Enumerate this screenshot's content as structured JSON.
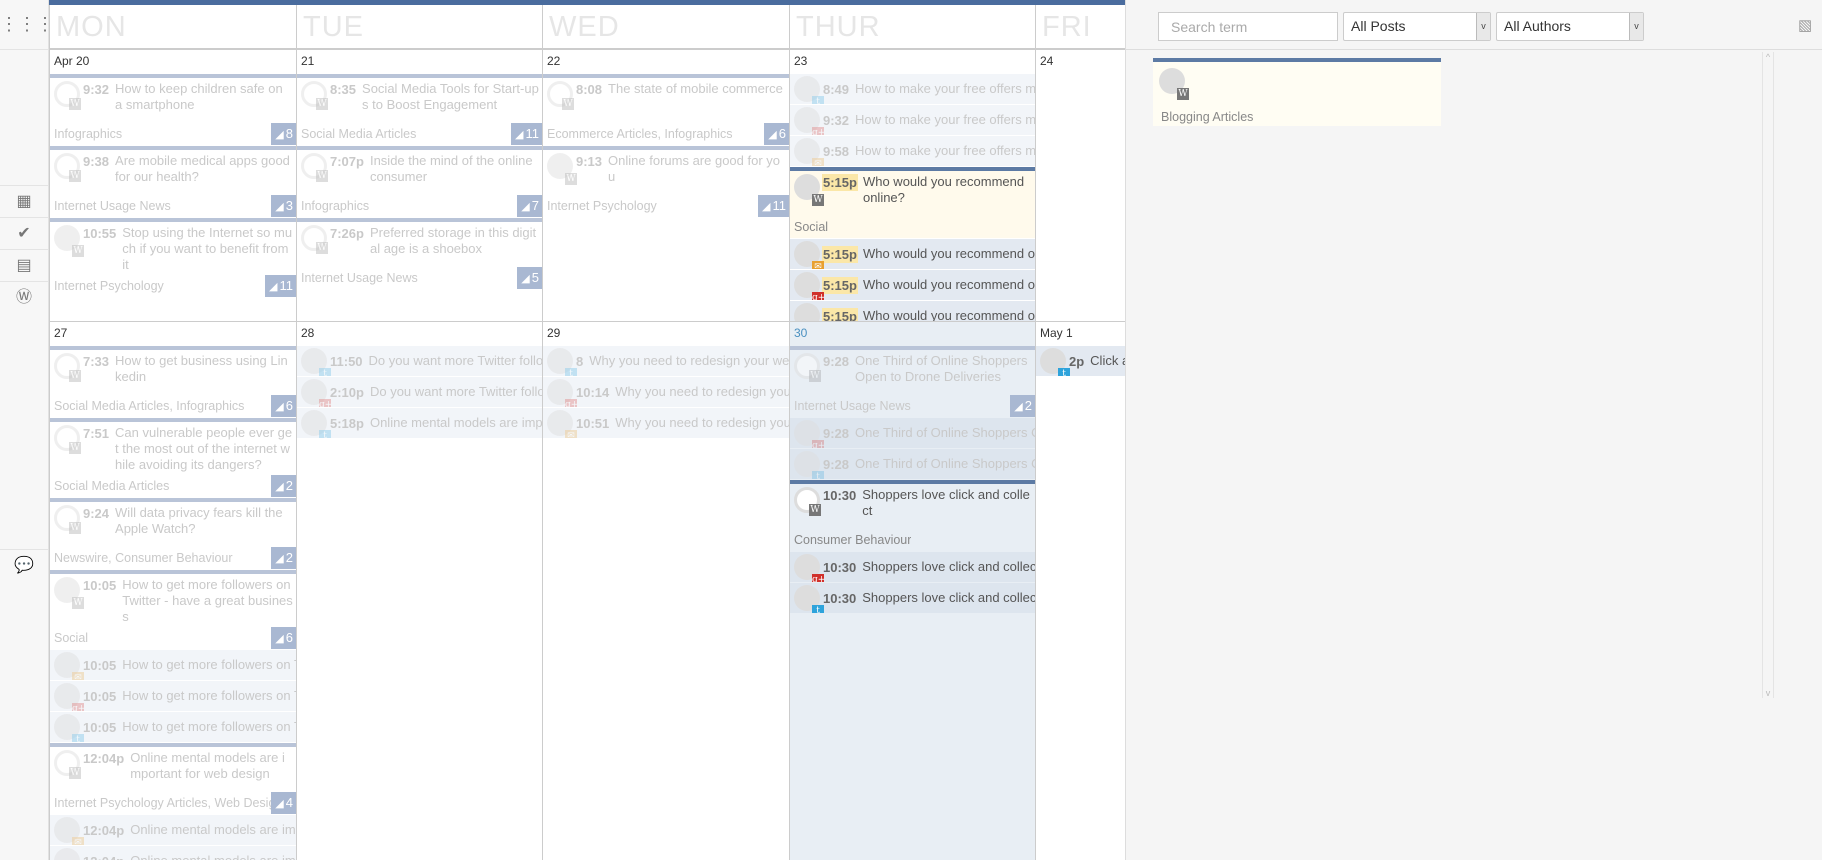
{
  "sidebar": {
    "icons": [
      "apps-grid-icon",
      "calendar-icon",
      "checkmark-icon",
      "document-icon",
      "wordpress-icon",
      "comment-icon"
    ]
  },
  "colors": {
    "accent": "#4a6c9e",
    "badge": "#8ea3c6",
    "twitter": "#2ea3db",
    "gplus": "#d0302a",
    "feed": "#e8a030",
    "wp": "#777777",
    "today_column": "#e8eef4"
  },
  "day_names": [
    "MON",
    "TUE",
    "WED",
    "THUR",
    "FRI"
  ],
  "weeks": [
    {
      "days": [
        {
          "date": "Apr 20",
          "items": [
            {
              "type": "post",
              "faded": true,
              "network": "wp",
              "avatar": "blank",
              "time": "9:32",
              "title": "How to keep children safe on a smartphone",
              "category": "Infographics",
              "count": "8"
            },
            {
              "type": "post",
              "faded": true,
              "network": "wp",
              "avatar": "blank",
              "time": "9:38",
              "title": "Are mobile medical apps good for our health?",
              "category": "Internet Usage News",
              "count": "3"
            },
            {
              "type": "post",
              "faded": true,
              "network": "wp",
              "avatar": "photo",
              "time": "10:55",
              "title": "Stop using the Internet so much if you want to benefit from it",
              "category": "Internet Psychology",
              "count": "11"
            }
          ]
        },
        {
          "date": "21",
          "items": [
            {
              "type": "post",
              "faded": true,
              "network": "wp",
              "avatar": "blank",
              "time": "8:35",
              "title": "Social Media Tools for Start-ups to Boost Engagement",
              "category": "Social Media Articles",
              "count": "11"
            },
            {
              "type": "post",
              "faded": true,
              "network": "wp",
              "avatar": "blank",
              "time": "7:07p",
              "title": "Inside the mind of the online consumer",
              "category": "Infographics",
              "count": "7"
            },
            {
              "type": "post",
              "faded": true,
              "network": "wp",
              "avatar": "blank",
              "time": "7:26p",
              "title": "Preferred storage in this digital age is a shoebox",
              "category": "Internet Usage News",
              "count": "5"
            }
          ]
        },
        {
          "date": "22",
          "items": [
            {
              "type": "post",
              "faded": true,
              "network": "wp",
              "avatar": "blank",
              "time": "8:08",
              "title": "The state of mobile commerce",
              "category": "Ecommerce Articles, Infographics",
              "count": "6"
            },
            {
              "type": "post",
              "faded": true,
              "network": "wp",
              "avatar": "photo",
              "time": "9:13",
              "title": "Online forums are good for you",
              "category": "Internet Psychology",
              "count": "11"
            }
          ]
        },
        {
          "date": "23",
          "items": [
            {
              "type": "social",
              "faded": true,
              "network": "twitter",
              "time": "8:49",
              "title": "How to make your free offers mor"
            },
            {
              "type": "social",
              "faded": true,
              "network": "gplus",
              "time": "9:32",
              "title": "How to make your free offers mor"
            },
            {
              "type": "social",
              "faded": true,
              "network": "feed",
              "time": "9:58",
              "title": "How to make your free offers mor"
            },
            {
              "type": "post",
              "active": true,
              "highlight": true,
              "network": "wp",
              "avatar": "photo",
              "time": "5:15p",
              "title": "Who would you recommend online?",
              "category": "Social"
            },
            {
              "type": "social",
              "active": true,
              "highlight": true,
              "network": "feed",
              "time": "5:15p",
              "title": "Who would you recommend onli"
            },
            {
              "type": "social",
              "active": true,
              "highlight": true,
              "network": "gplus",
              "time": "5:15p",
              "title": "Who would you recommend onli"
            },
            {
              "type": "social",
              "active": true,
              "highlight": true,
              "network": "twitter",
              "time": "5:15p",
              "title": "Who would you recommend onli"
            }
          ]
        },
        {
          "date": "24",
          "items": []
        }
      ]
    },
    {
      "days": [
        {
          "date": "27",
          "items": [
            {
              "type": "post",
              "faded": true,
              "network": "wp",
              "avatar": "blank",
              "time": "7:33",
              "title": "How to get business using Linkedin",
              "category": "Social Media Articles, Infographics",
              "count": "6"
            },
            {
              "type": "post",
              "faded": true,
              "network": "wp",
              "avatar": "blank",
              "time": "7:51",
              "title": "Can vulnerable people ever get the most out of the internet while avoiding its dangers?",
              "category": "Social Media Articles",
              "count": "2"
            },
            {
              "type": "post",
              "faded": true,
              "network": "wp",
              "avatar": "blank",
              "time": "9:24",
              "title": "Will data privacy fears kill the Apple Watch?",
              "category": "Newswire, Consumer Behaviour",
              "count": "2"
            },
            {
              "type": "post",
              "faded": true,
              "network": "wp",
              "avatar": "photo",
              "time": "10:05",
              "title": "How to get more followers on Twitter - have a great business",
              "category": "Social",
              "count": "6"
            },
            {
              "type": "social",
              "faded": true,
              "network": "feed",
              "time": "10:05",
              "title": "How to get more followers on T"
            },
            {
              "type": "social",
              "faded": true,
              "network": "gplus",
              "time": "10:05",
              "title": "How to get more followers on T"
            },
            {
              "type": "social",
              "faded": true,
              "network": "twitter",
              "time": "10:05",
              "title": "How to get more followers on T"
            },
            {
              "type": "post",
              "faded": true,
              "network": "wp",
              "avatar": "blank",
              "time": "12:04p",
              "title": "Online mental models are important for web design",
              "category": "Internet Psychology Articles, Web Design",
              "count": "4"
            },
            {
              "type": "social",
              "faded": true,
              "network": "feed",
              "time": "12:04p",
              "title": "Online mental models are imp"
            },
            {
              "type": "social",
              "faded": true,
              "network": "gplus",
              "time": "12:04p",
              "title": "Online mental models are imp"
            }
          ]
        },
        {
          "date": "28",
          "items": [
            {
              "type": "social",
              "faded": true,
              "network": "twitter",
              "time": "11:50",
              "title": "Do you want more Twitter follow-"
            },
            {
              "type": "social",
              "faded": true,
              "network": "gplus",
              "time": "2:10p",
              "title": "Do you want more Twitter follow-"
            },
            {
              "type": "social",
              "faded": true,
              "network": "twitter",
              "time": "5:18p",
              "title": "Online mental models are impo"
            }
          ]
        },
        {
          "date": "29",
          "items": [
            {
              "type": "social",
              "faded": true,
              "network": "twitter",
              "time": "8",
              "title": "Why you need to redesign your web"
            },
            {
              "type": "social",
              "faded": true,
              "network": "gplus",
              "time": "10:14",
              "title": "Why you need to redesign your"
            },
            {
              "type": "social",
              "faded": true,
              "network": "feed",
              "time": "10:51",
              "title": "Why you need to redesign your"
            }
          ]
        },
        {
          "date": "30",
          "today": true,
          "items": [
            {
              "type": "post",
              "faded": true,
              "network": "wp",
              "avatar": "blank",
              "time": "9:28",
              "title": "One Third of Online Shoppers Open to Drone Deliveries",
              "category": "Internet Usage News",
              "count": "2"
            },
            {
              "type": "social",
              "faded": true,
              "network": "gplus",
              "time": "9:28",
              "title": "One Third of Online Shoppers Op"
            },
            {
              "type": "social",
              "faded": true,
              "network": "twitter",
              "time": "9:28",
              "title": "One Third of Online Shoppers Op"
            },
            {
              "type": "post",
              "active": true,
              "network": "wp",
              "avatar": "blank",
              "time": "10:30",
              "title": "Shoppers love click and collect",
              "category": "Consumer Behaviour"
            },
            {
              "type": "social",
              "active": true,
              "network": "gplus",
              "time": "10:30",
              "title": "Shoppers love click and collect {"
            },
            {
              "type": "social",
              "active": true,
              "network": "twitter",
              "time": "10:30",
              "title": "Shoppers love click and collect {"
            }
          ]
        },
        {
          "date": "May 1",
          "items": [
            {
              "type": "social",
              "active": true,
              "network": "twitter",
              "time": "2p",
              "title": "Click ar"
            }
          ]
        }
      ]
    }
  ],
  "panel": {
    "search_placeholder": "Search term",
    "posts_filter": "All Posts",
    "authors_filter": "All Authors",
    "draft_card": {
      "category": "Blogging Articles",
      "network": "wp"
    }
  }
}
